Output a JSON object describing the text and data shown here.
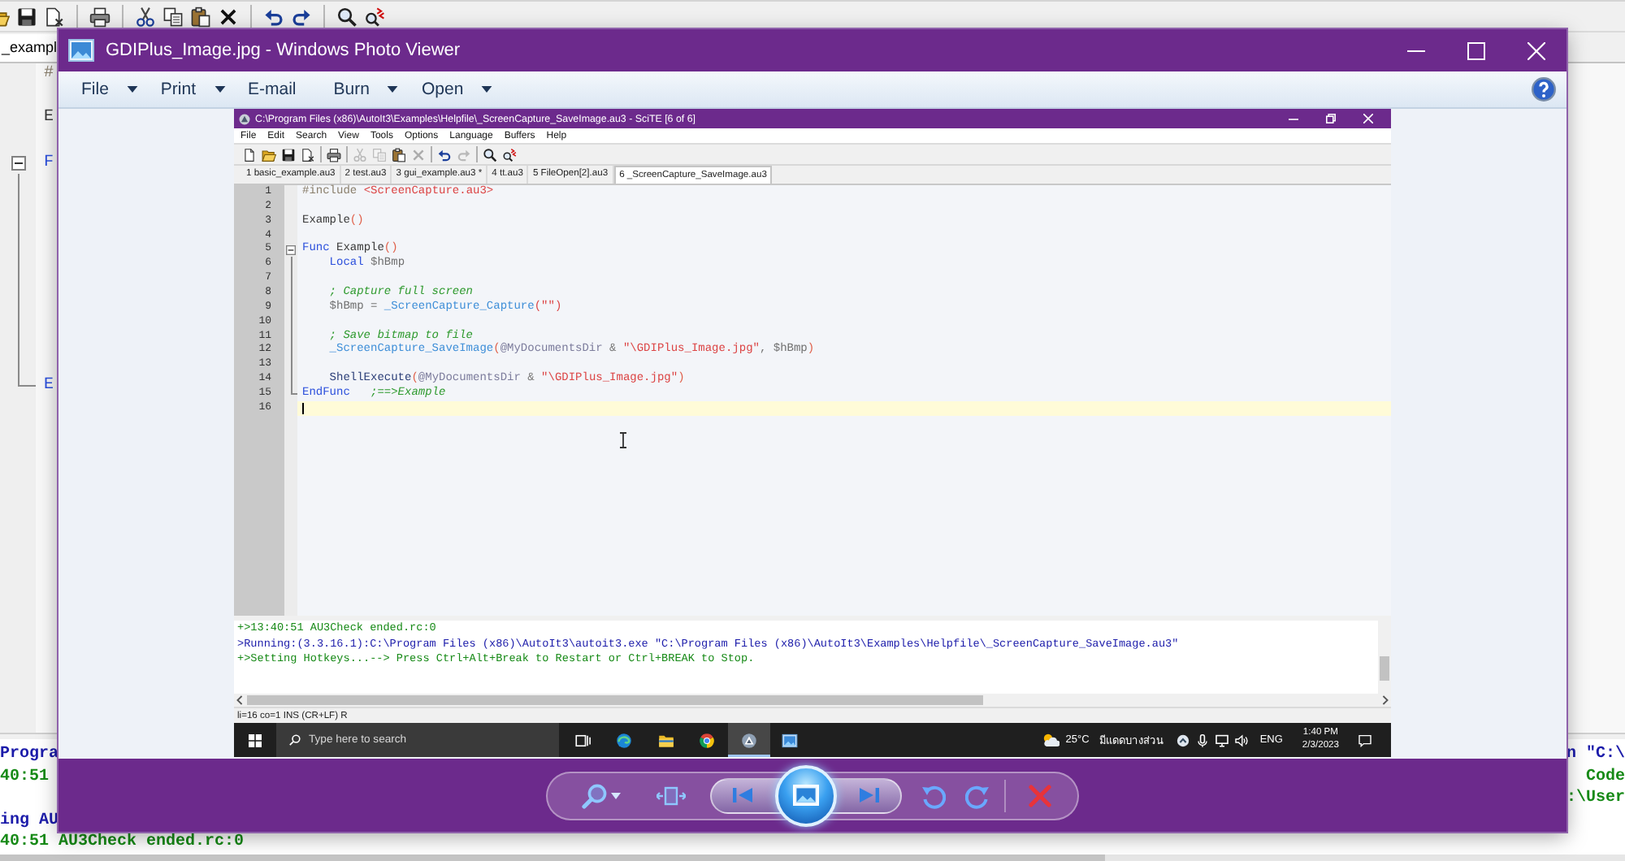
{
  "background_editor": {
    "toolbar_groups": [
      [
        {
          "kind": "open"
        },
        {
          "kind": "save"
        },
        {
          "kind": "close"
        }
      ],
      [
        {
          "kind": "print"
        }
      ],
      [
        {
          "kind": "cut"
        },
        {
          "kind": "copy"
        },
        {
          "kind": "paste"
        },
        {
          "kind": "delete"
        }
      ],
      [
        {
          "kind": "undo"
        },
        {
          "kind": "redo"
        }
      ],
      [
        {
          "kind": "find"
        },
        {
          "kind": "replace"
        }
      ]
    ],
    "tab": {
      "label": "_exampl"
    },
    "code_lines": [
      {
        "kind": "plain",
        "tokens": [
          {
            "text": "#",
            "kind": "directive"
          }
        ]
      },
      {
        "kind": "plain",
        "tokens": [
          {
            "text": "E",
            "kind": "function"
          }
        ]
      },
      {
        "kind": "fold_start",
        "tokens": [
          {
            "text": "F",
            "kind": "keyword"
          }
        ]
      },
      {
        "kind": "fold_end",
        "tokens": [
          {
            "text": "E",
            "kind": "keyword"
          }
        ]
      }
    ],
    "output_lines": [
      {
        "start": "Progra",
        "end": "n \"C:\\",
        "kind": "info"
      },
      {
        "start": "40:51",
        "end": "Code",
        "kind": "ok"
      },
      {
        "end": ":\\User",
        "kind": "ok"
      },
      {
        "start": "ing AU",
        "kind": "info"
      },
      {
        "start": "40:51 AU3Check ended.rc:0",
        "kind": "ok"
      }
    ]
  },
  "photo_viewer": {
    "title": "GDIPlus_Image.jpg - Windows Photo Viewer",
    "menu": [
      {
        "label": "File",
        "dropdown": true
      },
      {
        "label": "Print",
        "dropdown": true
      },
      {
        "label": "E-mail",
        "dropdown": false
      },
      {
        "label": "Burn",
        "dropdown": true
      },
      {
        "label": "Open",
        "dropdown": true
      }
    ],
    "screenshot": {
      "window_title": "C:\\Program Files (x86)\\AutoIt3\\Examples\\Helpfile\\_ScreenCapture_SaveImage.au3 - SciTE [6 of 6]",
      "menu": [
        "File",
        "Edit",
        "Search",
        "View",
        "Tools",
        "Options",
        "Language",
        "Buffers",
        "Help"
      ],
      "toolbar_groups": [
        [
          {
            "kind": "new",
            "disabled": false
          },
          {
            "kind": "open",
            "disabled": false
          },
          {
            "kind": "save",
            "disabled": false
          },
          {
            "kind": "close",
            "disabled": false
          }
        ],
        [
          {
            "kind": "print",
            "disabled": false
          }
        ],
        [
          {
            "kind": "cut",
            "disabled": true
          },
          {
            "kind": "copy",
            "disabled": true
          },
          {
            "kind": "paste",
            "disabled": false
          },
          {
            "kind": "delete",
            "disabled": true
          }
        ],
        [
          {
            "kind": "undo",
            "disabled": false
          },
          {
            "kind": "redo",
            "disabled": true
          }
        ],
        [
          {
            "kind": "find",
            "disabled": false
          },
          {
            "kind": "replace",
            "disabled": false
          }
        ]
      ],
      "tabs": [
        {
          "label": "1 basic_example.au3",
          "selected": false
        },
        {
          "label": "2 test.au3",
          "selected": false
        },
        {
          "label": "3 gui_example.au3 *",
          "selected": false
        },
        {
          "label": "4 tt.au3",
          "selected": false
        },
        {
          "label": "5 FileOpen[2].au3",
          "selected": false
        },
        {
          "label": "6 _ScreenCapture_SaveImage.au3",
          "selected": true
        }
      ],
      "code_lines": [
        {
          "number": "1",
          "current": false,
          "tokens": [
            {
              "text": "#include ",
              "kind": "directive"
            },
            {
              "text": "<ScreenCapture.au3>",
              "kind": "string"
            }
          ]
        },
        {
          "number": "2",
          "current": false
        },
        {
          "number": "3",
          "current": false,
          "tokens": [
            {
              "text": "Example",
              "kind": "function"
            },
            {
              "text": "()",
              "kind": "paren"
            }
          ]
        },
        {
          "number": "4",
          "current": false
        },
        {
          "number": "5",
          "current": false,
          "tokens": [
            {
              "text": "Func ",
              "kind": "keyword"
            },
            {
              "text": "Example",
              "kind": "function"
            },
            {
              "text": "()",
              "kind": "paren"
            }
          ],
          "children": [
            {
              "number": "6",
              "current": false,
              "tokens": [
                {
                  "text": "Local ",
                  "kind": "keyword"
                },
                {
                  "text": "$hBmp",
                  "kind": "variable"
                }
              ]
            },
            {
              "number": "7",
              "current": false
            },
            {
              "number": "8",
              "current": false,
              "tokens": [
                {
                  "text": "; Capture full screen",
                  "kind": "comment"
                }
              ]
            },
            {
              "number": "9",
              "current": false,
              "tokens": [
                {
                  "text": "$hBmp",
                  "kind": "variable"
                },
                {
                  "text": " = ",
                  "kind": "operator"
                },
                {
                  "text": "_ScreenCapture_Capture",
                  "kind": "udf"
                },
                {
                  "text": "(\"\")",
                  "kind": "string"
                }
              ]
            },
            {
              "number": "10",
              "current": false
            },
            {
              "number": "11",
              "current": false,
              "tokens": [
                {
                  "text": "; Save bitmap to file",
                  "kind": "comment"
                }
              ]
            },
            {
              "number": "12",
              "current": false,
              "tokens": [
                {
                  "text": "_ScreenCapture_SaveImage",
                  "kind": "udf"
                },
                {
                  "text": "(",
                  "kind": "paren"
                },
                {
                  "text": "@MyDocumentsDir",
                  "kind": "macro"
                },
                {
                  "text": " & ",
                  "kind": "operator"
                },
                {
                  "text": "\"\\GDIPlus_Image.jpg\"",
                  "kind": "string"
                },
                {
                  "text": ", ",
                  "kind": "operator"
                },
                {
                  "text": "$hBmp",
                  "kind": "variable"
                },
                {
                  "text": ")",
                  "kind": "paren"
                }
              ]
            },
            {
              "number": "13",
              "current": false
            },
            {
              "number": "14",
              "current": false,
              "tokens": [
                {
                  "text": "ShellExecute",
                  "kind": "builtin"
                },
                {
                  "text": "(",
                  "kind": "paren"
                },
                {
                  "text": "@MyDocumentsDir",
                  "kind": "macro"
                },
                {
                  "text": " & ",
                  "kind": "operator"
                },
                {
                  "text": "\"\\GDIPlus_Image.jpg\"",
                  "kind": "string"
                },
                {
                  "text": ")",
                  "kind": "paren"
                }
              ]
            }
          ]
        },
        {
          "number": "15",
          "current": false,
          "tokens": [
            {
              "text": "EndFunc",
              "kind": "keyword"
            },
            {
              "text": "   ;==>Example",
              "kind": "comment"
            }
          ]
        },
        {
          "number": "16",
          "current": true
        }
      ],
      "output_lines": [
        {
          "text": "+>13:40:51 AU3Check ended.rc:0",
          "kind": "ok"
        },
        {
          "text": ">Running:(3.3.16.1):C:\\Program Files (x86)\\AutoIt3\\autoit3.exe \"C:\\Program Files (x86)\\AutoIt3\\Examples\\Helpfile\\_ScreenCapture_SaveImage.au3\"",
          "kind": "info"
        },
        {
          "text": "+>Setting Hotkeys...--> Press Ctrl+Alt+Break to Restart or Ctrl+BREAK to Stop.",
          "kind": "ok"
        }
      ],
      "status_bar": "li=16 co=1 INS (CR+LF) R",
      "taskbar": {
        "search": {
          "placeholder": "Type here to search"
        },
        "apps": [
          {
            "kind": "task_view",
            "active": false
          },
          {
            "kind": "swirl",
            "active": false
          },
          {
            "kind": "folder",
            "active": false
          },
          {
            "kind": "segmented_circle",
            "active": false
          },
          {
            "kind": "triangle_disc",
            "active": true
          },
          {
            "kind": "picture",
            "active": false
          }
        ],
        "weather": {
          "temperature": "25°C",
          "condition": "มีแดดบางส่วน"
        },
        "language": "ENG",
        "time": "1:40 PM",
        "date": "2/3/2023"
      }
    }
  }
}
